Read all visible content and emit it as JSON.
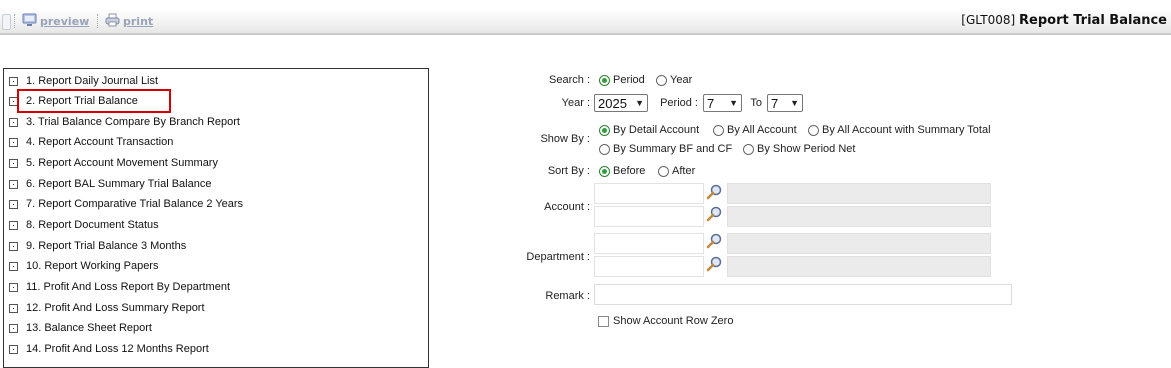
{
  "toolbar": {
    "preview_label": "preview",
    "print_label": "print",
    "report_code": "[GLT008]",
    "report_title": "Report Trial Balance"
  },
  "report_list": [
    "1. Report Daily Journal List",
    "2. Report Trial Balance",
    "3. Trial Balance Compare By Branch Report",
    "4. Report Account Transaction",
    "5. Report Account Movement Summary",
    "6. Report BAL Summary Trial Balance",
    "7. Report Comparative Trial Balance 2 Years",
    "8. Report Document Status",
    "9. Report Trial Balance 3 Months",
    "10. Report Working Papers",
    "11. Profit And Loss Report By Department",
    "12. Profit And Loss Summary Report",
    "13. Balance Sheet Report",
    "14. Profit And Loss 12 Months Report"
  ],
  "selected_report": "2. Report Trial Balance",
  "form": {
    "search_label": "Search :",
    "search_options": [
      "Period",
      "Year"
    ],
    "search_selected": "Period",
    "year_label": "Year :",
    "year_value": "2025",
    "period_label": "Period :",
    "period_from": "7",
    "to_label": "To",
    "period_to": "7",
    "show_by_label": "Show By :",
    "show_by_options": [
      "By Detail Account",
      "By All Account",
      "By All Account with Summary Total",
      "By Summary BF and CF",
      "By Show Period Net"
    ],
    "show_by_selected": "By Detail Account",
    "sort_by_label": "Sort By :",
    "sort_by_options": [
      "Before",
      "After"
    ],
    "sort_by_selected": "Before",
    "account_label": "Account :",
    "department_label": "Department :",
    "remark_label": "Remark :",
    "remark_value": "",
    "show_zero_label": "Show Account Row Zero",
    "show_zero_checked": false
  },
  "colors": {
    "radio_selected": "#2e9d3a",
    "highlight_border": "#d40000",
    "lookup_field_bg": "#ebebeb",
    "toolbar_link": "#9aa3b8"
  },
  "icons": [
    "preview-icon",
    "print-icon",
    "search-lookup-icon"
  ]
}
